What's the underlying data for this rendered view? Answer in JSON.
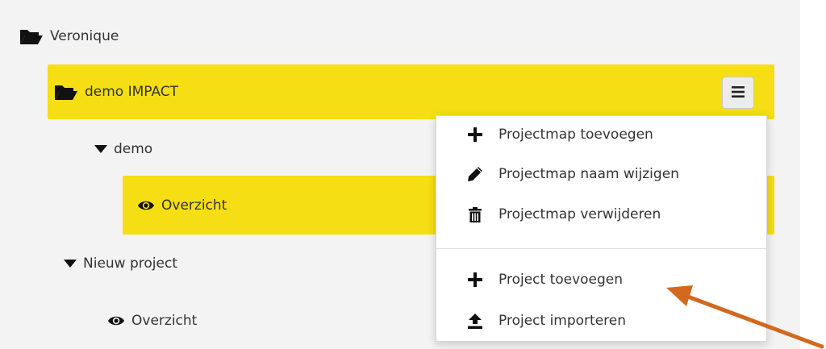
{
  "tree": {
    "root": {
      "label": "Veronique",
      "icon": "folder-open-icon"
    },
    "selected_folder": {
      "label": "demo IMPACT",
      "icon": "folder-open-icon"
    },
    "project_demo": {
      "label": "demo",
      "icon": "caret-down-icon"
    },
    "demo_overview": {
      "label": "Overzicht",
      "icon": "eye-icon"
    },
    "project_new": {
      "label": "Nieuw project",
      "icon": "caret-down-icon"
    },
    "new_overview": {
      "label": "Overzicht",
      "icon": "eye-icon"
    }
  },
  "hamburger": {
    "icon": "hamburger-menu-icon"
  },
  "context_menu": {
    "items": [
      {
        "label": "Projectmap toevoegen",
        "icon": "plus-icon"
      },
      {
        "label": "Projectmap naam wijzigen",
        "icon": "pencil-icon"
      },
      {
        "label": "Projectmap verwijderen",
        "icon": "trash-icon"
      },
      {
        "label": "Project toevoegen",
        "icon": "plus-icon"
      },
      {
        "label": "Project importeren",
        "icon": "upload-icon"
      }
    ]
  },
  "annotation": {
    "icon": "pointer-arrow-icon",
    "color": "#d2691e"
  },
  "colors": {
    "highlight": "#f5de13",
    "panel": "#f3f3f3",
    "text": "#333333"
  }
}
